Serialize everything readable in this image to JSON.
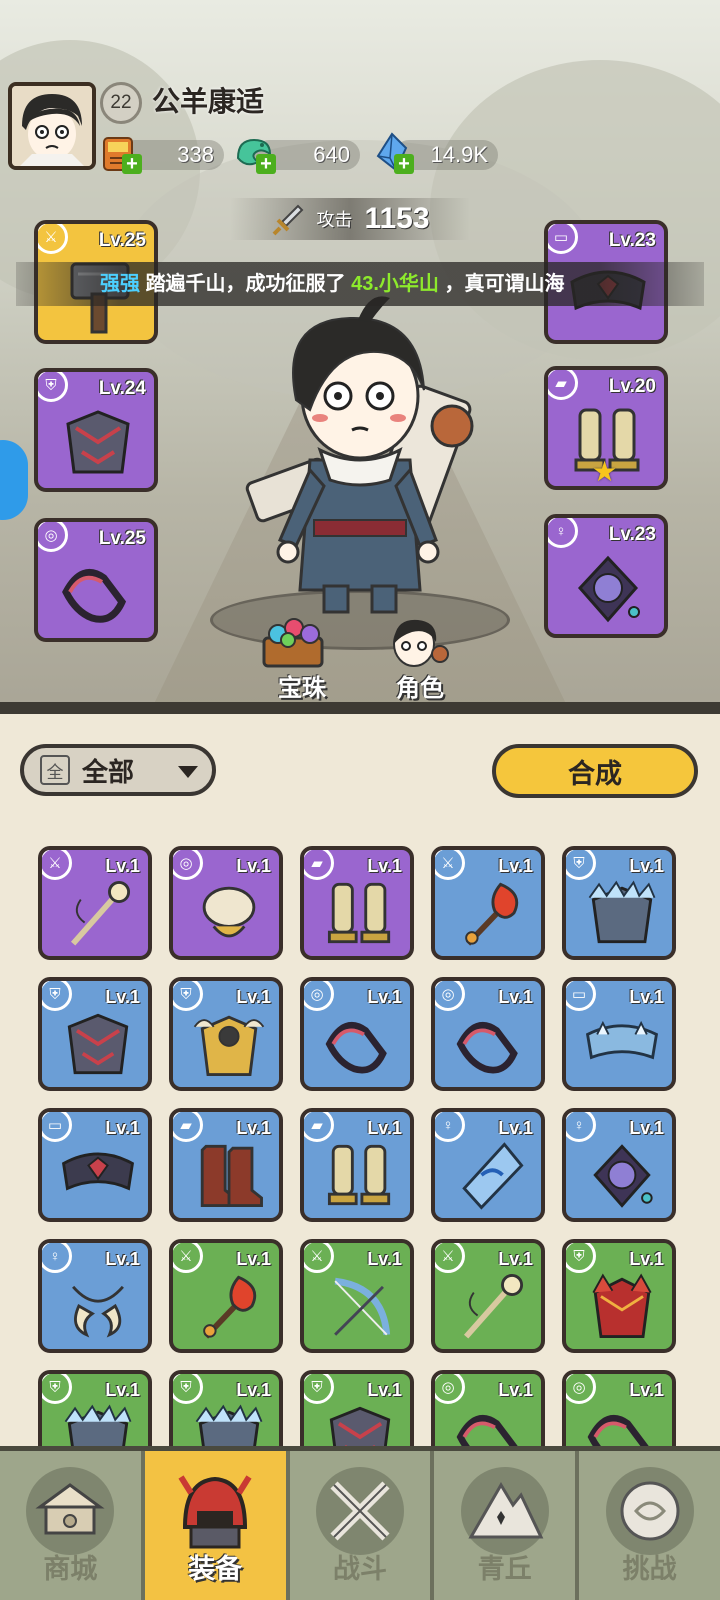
{
  "player": {
    "name": "公羊康适",
    "level": "22"
  },
  "resources": [
    {
      "icon": "ticket-icon",
      "value": "338"
    },
    {
      "icon": "jade-dragon-icon",
      "value": "640"
    },
    {
      "icon": "crystal-icon",
      "value": "14.9K"
    }
  ],
  "attack": {
    "label": "攻击",
    "value": "1153"
  },
  "marquee": {
    "name": "强强",
    "text1": "踏遍千山，成功征服了",
    "place": "43.小华山",
    "text2": "，真可谓山海"
  },
  "equipped": {
    "left": [
      {
        "level": "Lv.25",
        "slot_icon": "sword-icon",
        "item": "hammer",
        "rarity": "gold"
      },
      {
        "level": "Lv.24",
        "slot_icon": "armor-icon",
        "item": "chestplate",
        "rarity": "purple"
      },
      {
        "level": "Lv.25",
        "slot_icon": "bracer-icon",
        "item": "bracer",
        "rarity": "purple"
      }
    ],
    "right": [
      {
        "level": "Lv.23",
        "slot_icon": "belt-icon",
        "item": "belt",
        "rarity": "purple"
      },
      {
        "level": "Lv.20",
        "slot_icon": "boots-icon",
        "item": "boots",
        "rarity": "purple",
        "star": true
      },
      {
        "level": "Lv.23",
        "slot_icon": "amulet-icon",
        "item": "amulet",
        "rarity": "purple"
      }
    ]
  },
  "character_buttons": {
    "gems": "宝珠",
    "role": "角色"
  },
  "filter": {
    "box": "全",
    "label": "全部"
  },
  "synthesize": "合成",
  "inventory": [
    {
      "level": "Lv.1",
      "rarity": "purple",
      "slot_icon": "sword-icon",
      "item": "staff"
    },
    {
      "level": "Lv.1",
      "rarity": "purple",
      "slot_icon": "bracer-icon",
      "item": "bracer-gold"
    },
    {
      "level": "Lv.1",
      "rarity": "purple",
      "slot_icon": "boots-icon",
      "item": "boots"
    },
    {
      "level": "Lv.1",
      "rarity": "blue",
      "slot_icon": "sword-icon",
      "item": "fire-staff"
    },
    {
      "level": "Lv.1",
      "rarity": "blue",
      "slot_icon": "armor-icon",
      "item": "ice-armor"
    },
    {
      "level": "Lv.1",
      "rarity": "blue",
      "slot_icon": "armor-icon",
      "item": "chestplate"
    },
    {
      "level": "Lv.1",
      "rarity": "blue",
      "slot_icon": "armor-icon",
      "item": "gold-armor"
    },
    {
      "level": "Lv.1",
      "rarity": "blue",
      "slot_icon": "bracer-icon",
      "item": "bracer"
    },
    {
      "level": "Lv.1",
      "rarity": "blue",
      "slot_icon": "bracer-icon",
      "item": "bracer"
    },
    {
      "level": "Lv.1",
      "rarity": "blue",
      "slot_icon": "belt-icon",
      "item": "ice-belt"
    },
    {
      "level": "Lv.1",
      "rarity": "blue",
      "slot_icon": "belt-icon",
      "item": "belt"
    },
    {
      "level": "Lv.1",
      "rarity": "blue",
      "slot_icon": "boots-icon",
      "item": "red-boots"
    },
    {
      "level": "Lv.1",
      "rarity": "blue",
      "slot_icon": "boots-icon",
      "item": "boots"
    },
    {
      "level": "Lv.1",
      "rarity": "blue",
      "slot_icon": "amulet-icon",
      "item": "ice-amulet"
    },
    {
      "level": "Lv.1",
      "rarity": "blue",
      "slot_icon": "amulet-icon",
      "item": "amulet"
    },
    {
      "level": "Lv.1",
      "rarity": "blue",
      "slot_icon": "amulet-icon",
      "item": "horn-amulet"
    },
    {
      "level": "Lv.1",
      "rarity": "green",
      "slot_icon": "sword-icon",
      "item": "fire-staff"
    },
    {
      "level": "Lv.1",
      "rarity": "green",
      "slot_icon": "sword-icon",
      "item": "bow"
    },
    {
      "level": "Lv.1",
      "rarity": "green",
      "slot_icon": "sword-icon",
      "item": "staff"
    },
    {
      "level": "Lv.1",
      "rarity": "green",
      "slot_icon": "armor-icon",
      "item": "red-armor"
    },
    {
      "level": "Lv.1",
      "rarity": "green",
      "slot_icon": "armor-icon",
      "item": "ice-armor"
    },
    {
      "level": "Lv.1",
      "rarity": "green",
      "slot_icon": "armor-icon",
      "item": "ice-armor"
    },
    {
      "level": "Lv.1",
      "rarity": "green",
      "slot_icon": "armor-icon",
      "item": "chestplate"
    },
    {
      "level": "Lv.1",
      "rarity": "green",
      "slot_icon": "bracer-icon",
      "item": "bracer"
    },
    {
      "level": "Lv.1",
      "rarity": "green",
      "slot_icon": "bracer-icon",
      "item": "bracer"
    }
  ],
  "nav": [
    {
      "label": "商城",
      "icon": "shop-icon",
      "active": false
    },
    {
      "label": "装备",
      "icon": "helmet-icon",
      "active": true
    },
    {
      "label": "战斗",
      "icon": "crossed-swords-icon",
      "active": false
    },
    {
      "label": "青丘",
      "icon": "mountain-icon",
      "active": false
    },
    {
      "label": "挑战",
      "icon": "challenge-orb-icon",
      "active": false
    }
  ],
  "colors": {
    "purple": "#9a66cf",
    "blue": "#6b9ed6",
    "green": "#6bb054",
    "gold": "#f3c43f",
    "nav_active": "#f3c243"
  }
}
